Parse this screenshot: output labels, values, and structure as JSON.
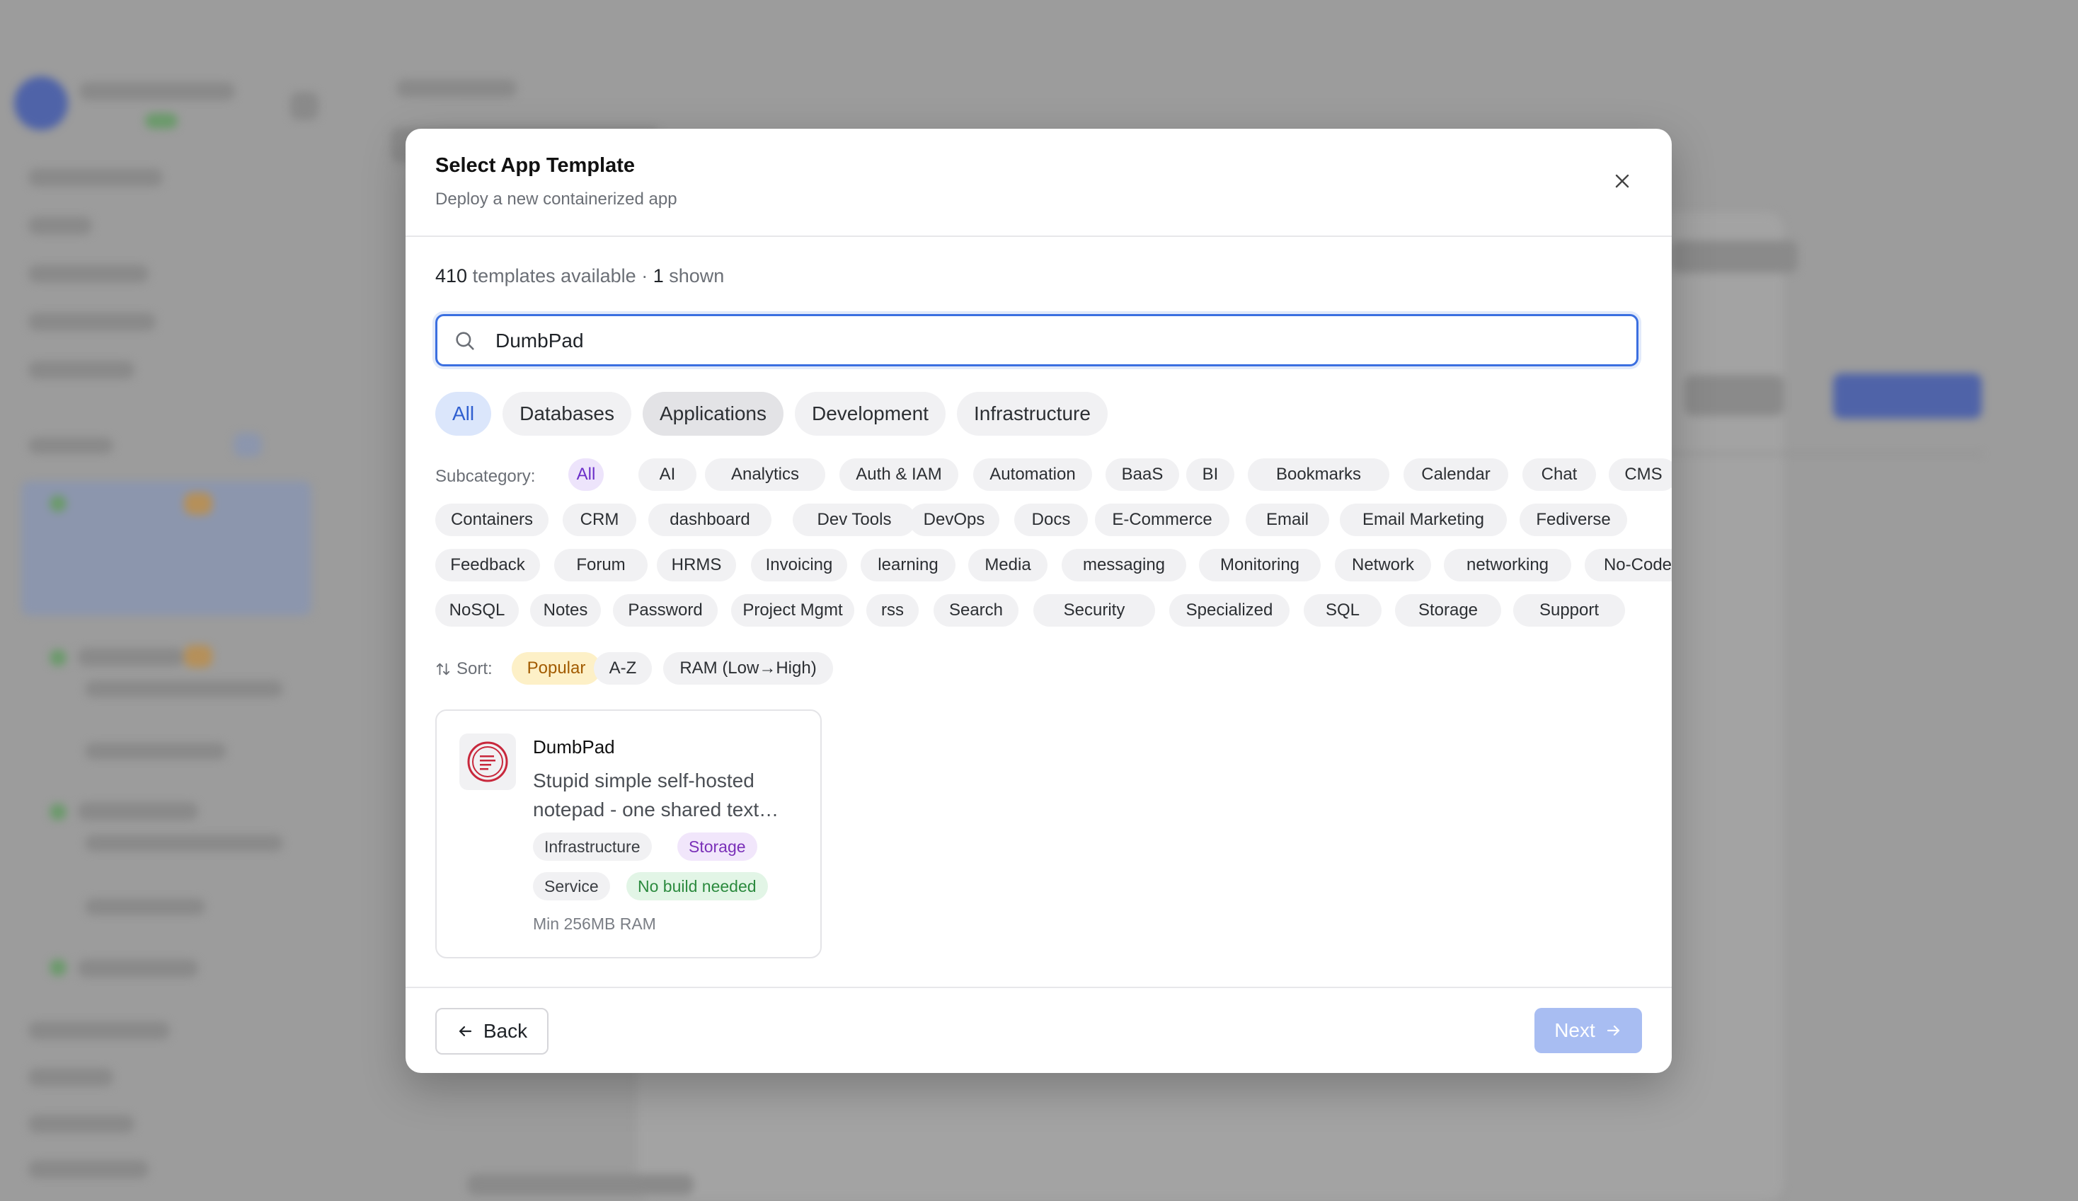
{
  "modal": {
    "title": "Select App Template",
    "subtitle": "Deploy a new containerized app",
    "count_total": "410",
    "count_total_suffix": " templates available · ",
    "count_shown": "1",
    "count_shown_suffix": " shown"
  },
  "search": {
    "value": "DumbPad"
  },
  "tabs": [
    {
      "label": "All",
      "active": true
    },
    {
      "label": "Databases"
    },
    {
      "label": "Applications",
      "hover": true
    },
    {
      "label": "Development"
    },
    {
      "label": "Infrastructure"
    }
  ],
  "subcategory": {
    "label": "Subcategory:",
    "chips": [
      "All",
      "AI",
      "Analytics",
      "Auth & IAM",
      "Automation",
      "BaaS",
      "BI",
      "Bookmarks",
      "Calendar",
      "Chat",
      "CMS",
      "Containers",
      "CRM",
      "dashboard",
      "Dev Tools",
      "DevOps",
      "Docs",
      "E-Commerce",
      "Email",
      "Email Marketing",
      "Fediverse",
      "Feedback",
      "Forum",
      "HRMS",
      "Invoicing",
      "learning",
      "Media",
      "messaging",
      "Monitoring",
      "Network",
      "networking",
      "No-Code",
      "NoSQL",
      "Notes",
      "Password",
      "Project Mgmt",
      "rss",
      "Search",
      "Security",
      "Specialized",
      "SQL",
      "Storage",
      "Support"
    ],
    "active": "All"
  },
  "sort": {
    "label": "Sort:",
    "options": [
      "Popular",
      "A-Z",
      "RAM (Low→High)"
    ],
    "active": "Popular"
  },
  "card": {
    "name": "DumbPad",
    "description": "Stupid simple self-hosted notepad - one shared text…",
    "tags": [
      "Infrastructure",
      "Storage",
      "Service",
      "No build needed"
    ],
    "ram": "Min 256MB RAM",
    "logo_color": "#c0392b"
  },
  "footer": {
    "back_label": "Back",
    "next_label": "Next"
  },
  "colors": {
    "accent": "#3b6fe0",
    "next_disabled": "#a8bdf2"
  }
}
